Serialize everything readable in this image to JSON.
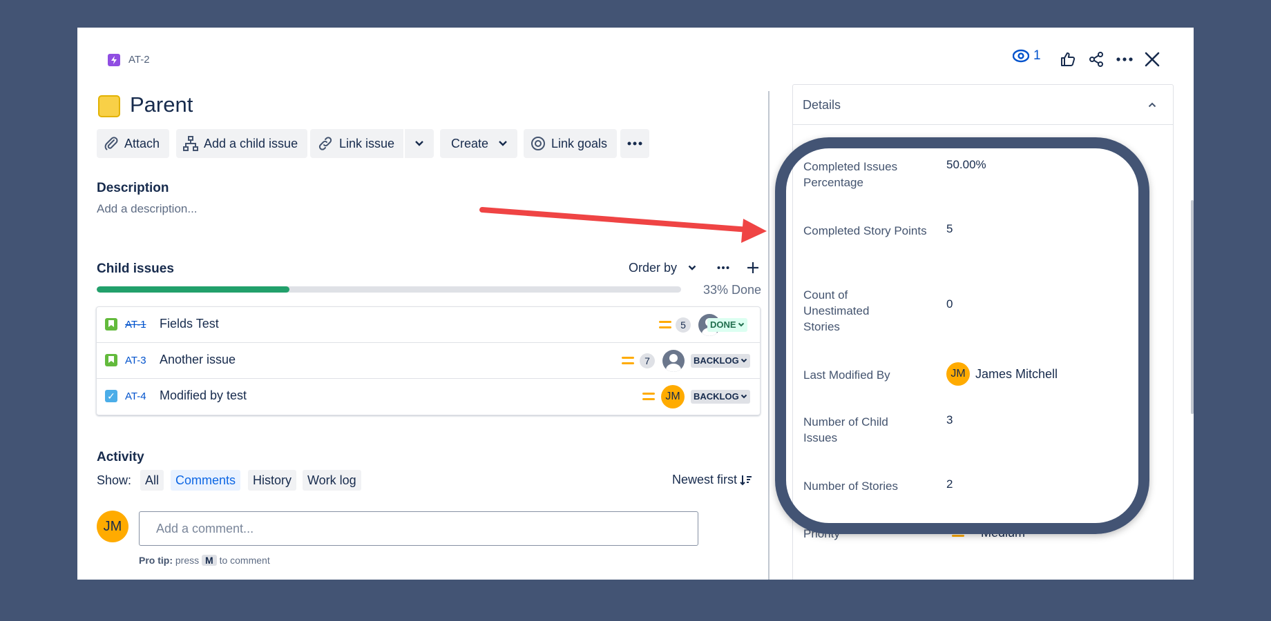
{
  "header": {
    "issue_key": "AT-2",
    "watch_count": "1"
  },
  "issue": {
    "title": "Parent"
  },
  "toolbar": {
    "attach": "Attach",
    "add_child": "Add a child issue",
    "link_issue": "Link issue",
    "create": "Create",
    "link_goals": "Link goals"
  },
  "description": {
    "title": "Description",
    "placeholder": "Add a description..."
  },
  "child_issues": {
    "title": "Child issues",
    "order_by": "Order by",
    "progress_fraction": 0.33,
    "progress_label": "33% Done",
    "items": [
      {
        "key": "AT-1",
        "summary": "Fields Test",
        "points": "5",
        "status": "DONE",
        "done": true,
        "type": "story"
      },
      {
        "key": "AT-3",
        "summary": "Another issue",
        "points": "7",
        "status": "BACKLOG",
        "done": false,
        "type": "story"
      },
      {
        "key": "AT-4",
        "summary": "Modified by test",
        "status": "BACKLOG",
        "done": false,
        "type": "task",
        "assignee_initials": "JM"
      }
    ]
  },
  "activity": {
    "title": "Activity",
    "show_label": "Show:",
    "filters": [
      "All",
      "Comments",
      "History",
      "Work log"
    ],
    "selected_filter": "Comments",
    "sort": "Newest first",
    "avatar_initials": "JM",
    "comment_placeholder": "Add a comment...",
    "pro_tip_label": "Pro tip:",
    "pro_tip_press": "press",
    "pro_tip_key": "M",
    "pro_tip_rest": "to comment"
  },
  "details": {
    "title": "Details",
    "fields": [
      {
        "label": "Completed Issues Percentage",
        "value": "50.00%"
      },
      {
        "label": "Completed Story Points",
        "value": "5"
      },
      {
        "label": "Count of Unestimated Stories",
        "value": "0"
      },
      {
        "label": "Last Modified By",
        "value": "James Mitchell",
        "avatar_initials": "JM"
      },
      {
        "label": "Number of Child Issues",
        "value": "3"
      },
      {
        "label": "Number of Stories",
        "value": "2"
      },
      {
        "label": "Priority",
        "value": "Medium"
      }
    ]
  },
  "colors": {
    "backdrop": "#435474",
    "progress": "#22A06B",
    "link": "#0052CC",
    "arrow": "#EF4444",
    "priority_medium": "#FFAB00"
  }
}
